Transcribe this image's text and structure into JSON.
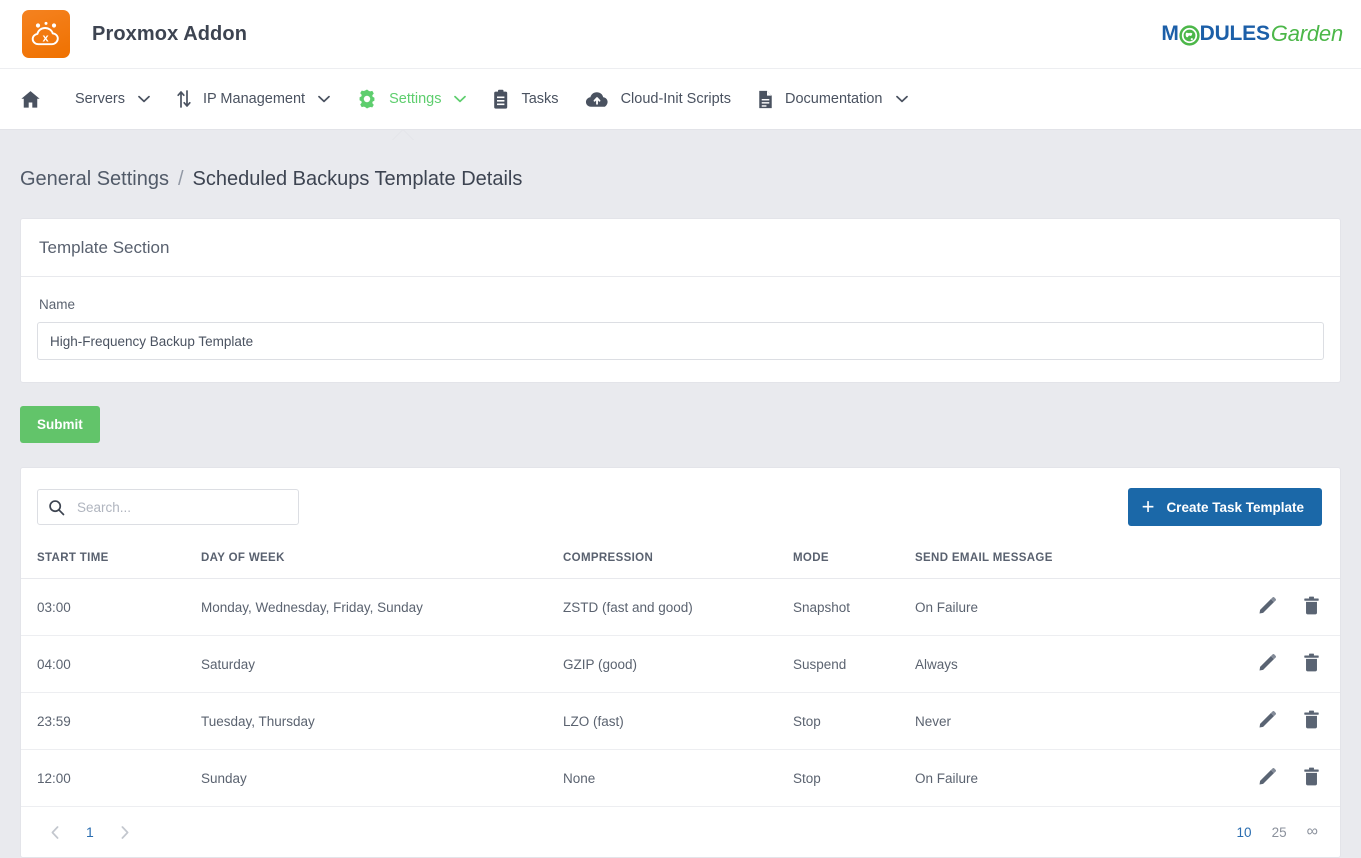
{
  "header": {
    "app_title": "Proxmox Addon",
    "logo_icon": "proxmox-cloud-icon",
    "vendor_logo": {
      "part1": "M",
      "globe_icon": "globe-icon",
      "part2": "DULES",
      "part3": "Garden"
    }
  },
  "nav": {
    "items": [
      {
        "label": "",
        "icon": "home-icon",
        "caret": false,
        "active": false,
        "name": "home"
      },
      {
        "label": "Servers",
        "icon": "none",
        "caret": true,
        "active": false,
        "name": "servers"
      },
      {
        "label": "IP Management",
        "icon": "exchange-arrows-icon",
        "caret": true,
        "active": false,
        "name": "ip-management"
      },
      {
        "label": "Settings",
        "icon": "gear-icon",
        "caret": true,
        "active": true,
        "name": "settings"
      },
      {
        "label": "Tasks",
        "icon": "clipboard-icon",
        "caret": false,
        "active": false,
        "name": "tasks"
      },
      {
        "label": "Cloud-Init Scripts",
        "icon": "cloud-upload-icon",
        "caret": false,
        "active": false,
        "name": "cloud-init-scripts"
      },
      {
        "label": "Documentation",
        "icon": "document-icon",
        "caret": true,
        "active": false,
        "name": "documentation"
      }
    ],
    "active_color": "#5ece6e"
  },
  "breadcrumb": {
    "parent": "General Settings",
    "separator": "/",
    "current": "Scheduled Backups Template Details"
  },
  "template_section": {
    "title": "Template Section",
    "name_label": "Name",
    "name_value": "High-Frequency Backup Template",
    "name_placeholder": "Name"
  },
  "submit": {
    "label": "Submit",
    "color": "#62c46a"
  },
  "table_panel": {
    "search_placeholder": "Search...",
    "search_value": "",
    "search_icon": "search-icon",
    "create_button": {
      "label": "Create Task Template",
      "icon": "plus-icon",
      "color": "#1b68a8"
    },
    "columns": [
      "START TIME",
      "DAY OF WEEK",
      "COMPRESSION",
      "MODE",
      "SEND EMAIL MESSAGE",
      ""
    ],
    "rows": [
      {
        "start_time": "03:00",
        "day_of_week": "Monday, Wednesday, Friday, Sunday",
        "compression": "ZSTD (fast and good)",
        "mode": "Snapshot",
        "send_email_message": "On Failure",
        "edit_icon": "pencil-icon",
        "delete_icon": "trash-icon"
      },
      {
        "start_time": "04:00",
        "day_of_week": "Saturday",
        "compression": "GZIP (good)",
        "mode": "Suspend",
        "send_email_message": "Always",
        "edit_icon": "pencil-icon",
        "delete_icon": "trash-icon"
      },
      {
        "start_time": "23:59",
        "day_of_week": "Tuesday, Thursday",
        "compression": "LZO (fast)",
        "mode": "Stop",
        "send_email_message": "Never",
        "edit_icon": "pencil-icon",
        "delete_icon": "trash-icon"
      },
      {
        "start_time": "12:00",
        "day_of_week": "Sunday",
        "compression": "None",
        "mode": "Stop",
        "send_email_message": "On Failure",
        "edit_icon": "pencil-icon",
        "delete_icon": "trash-icon"
      }
    ],
    "pagination": {
      "prev_icon": "chevron-left-icon",
      "next_icon": "chevron-right-icon",
      "current_page": "1",
      "page_sizes": [
        "10",
        "25",
        "∞"
      ],
      "active_size": "10"
    }
  }
}
